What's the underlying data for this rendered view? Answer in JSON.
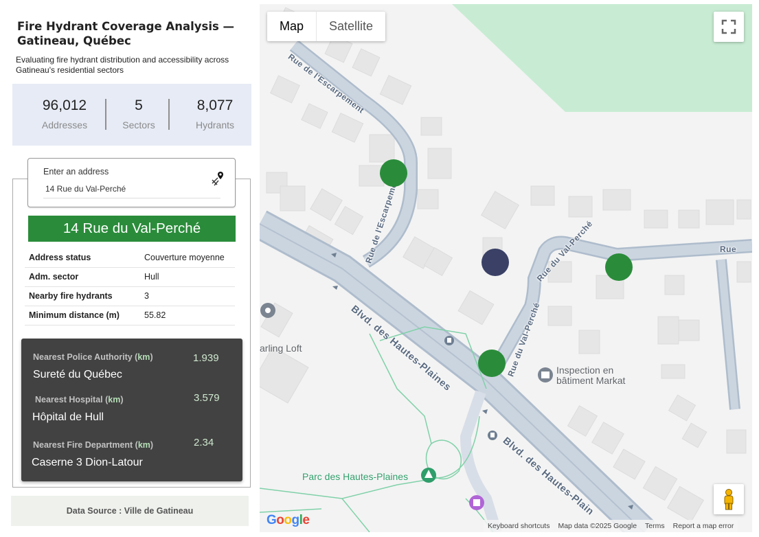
{
  "header": {
    "title": "Fire Hydrant Coverage Analysis — Gatineau, Québec",
    "subtitle": "Evaluating fire hydrant distribution and accessibility across Gatineau's residential sectors"
  },
  "stats": [
    {
      "value": "96,012",
      "label": "Addresses"
    },
    {
      "value": "5",
      "label": "Sectors"
    },
    {
      "value": "8,077",
      "label": "Hydrants"
    }
  ],
  "search": {
    "label": "Enter an address",
    "value": "14 Rue du Val-Perché",
    "icon": "map-pin-icon"
  },
  "selected": {
    "address": "14 Rue du Val-Perché",
    "color": "#2a8c3a",
    "rows": [
      {
        "key": "Address status",
        "value": "Couverture moyenne"
      },
      {
        "key": "Adm. sector",
        "value": "Hull"
      },
      {
        "key": "Nearby fire hydrants",
        "value": "3"
      },
      {
        "key": "Minimum distance (m)",
        "value": "55.82"
      }
    ]
  },
  "nearest": [
    {
      "label": "Nearest Police Authority (",
      "unit": "km",
      "close": ")",
      "name": "Sureté du Québec",
      "distance": "1.939"
    },
    {
      "label": "Nearest Hospital (",
      "unit": "km",
      "close": ")",
      "name": "Hôpital de Hull",
      "distance": "3.579"
    },
    {
      "label": "Nearest Fire Department (",
      "unit": "km",
      "close": ")",
      "name": "Caserne 3 Dion-Latour",
      "distance": "2.34"
    }
  ],
  "source": "Data Source : Ville de Gatineau",
  "map": {
    "type_buttons": [
      "Map",
      "Satellite"
    ],
    "active_type": "Map",
    "streets": {
      "escarpement_top": "Rue de l'Escarpement",
      "escarpement_side": "Rue de l'Escarpement",
      "val_perche_top": "Rue du Val-Perché",
      "val_perche_side": "Rue du Val-Perché",
      "rue_right": "Rue",
      "blvd_1": "Blvd. des Hautes-Plaines",
      "blvd_2": "Blvd. des Hautes-Plain"
    },
    "pois": {
      "poi_left": "arling Loft",
      "inspection": "Inspection en bâtiment Markat",
      "park": "Parc des Hautes-Plaines"
    },
    "markers": [
      {
        "type": "hydrant",
        "color": "#2a8c3a"
      },
      {
        "type": "address",
        "color": "#3a4066"
      },
      {
        "type": "hydrant",
        "color": "#2a8c3a"
      },
      {
        "type": "hydrant",
        "color": "#2a8c3a"
      }
    ],
    "footer": [
      "Keyboard shortcuts",
      "Map data ©2025 Google",
      "Terms",
      "Report a map error"
    ],
    "logo": "Google"
  }
}
